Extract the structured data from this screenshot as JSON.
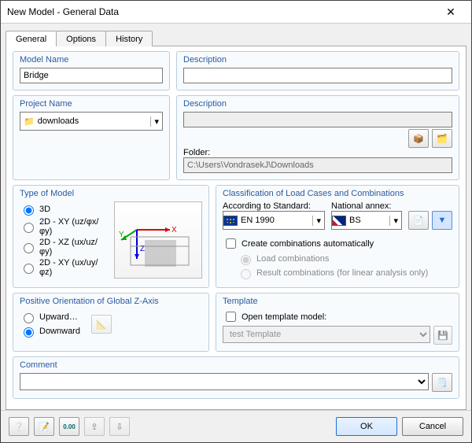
{
  "window": {
    "title": "New Model - General Data"
  },
  "tabs": {
    "general": "General",
    "options": "Options",
    "history": "History"
  },
  "modelName": {
    "legend": "Model Name",
    "value": "Bridge"
  },
  "modelDesc": {
    "legend": "Description",
    "value": ""
  },
  "projectName": {
    "legend": "Project Name",
    "value": "downloads"
  },
  "projectDesc": {
    "legend": "Description",
    "value": ""
  },
  "folder": {
    "label": "Folder:",
    "value": "C:\\Users\\VondrasekJ\\Downloads"
  },
  "typeOfModel": {
    "legend": "Type of Model",
    "opts": {
      "d3": "3D",
      "d2xy": "2D - XY (uz/φx/φy)",
      "d2xz": "2D - XZ (ux/uz/φy)",
      "d2xy2": "2D - XY (ux/uy/φz)"
    }
  },
  "classification": {
    "legend": "Classification of Load Cases and Combinations",
    "standardLabel": "According to Standard:",
    "annexLabel": "National annex:",
    "standard": "EN 1990",
    "annex": "BS",
    "auto": "Create combinations automatically",
    "loadComb": "Load combinations",
    "resultComb": "Result combinations (for linear analysis only)"
  },
  "zAxis": {
    "legend": "Positive Orientation of Global Z-Axis",
    "up": "Upward…",
    "down": "Downward"
  },
  "template": {
    "legend": "Template",
    "open": "Open template model:",
    "value": "test Template"
  },
  "comment": {
    "legend": "Comment"
  },
  "buttons": {
    "ok": "OK",
    "cancel": "Cancel"
  }
}
